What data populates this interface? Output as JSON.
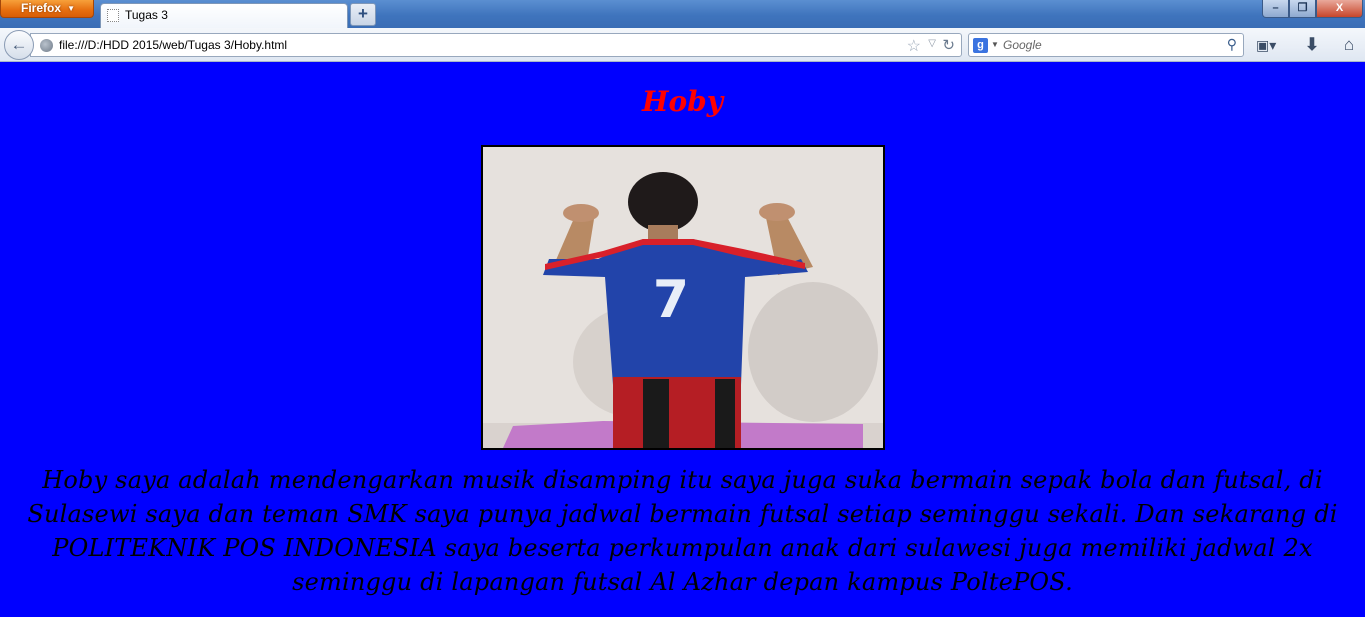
{
  "browser": {
    "menu_label": "Firefox",
    "tab": {
      "title": "Tugas 3"
    },
    "address": "file:///D:/HDD 2015/web/Tugas 3/Hoby.html",
    "search": {
      "engine": "Google",
      "placeholder": "Google"
    },
    "new_tab_label": "+",
    "window_controls": {
      "minimize": "–",
      "restore": "❐",
      "close": "X"
    }
  },
  "page": {
    "background_color": "#0000ff",
    "heading": "Hoby",
    "heading_color": "#ff0000",
    "photo": {
      "jersey_number": "7"
    },
    "paragraph": "Hoby saya adalah mendengarkan musik disamping itu saya juga suka bermain sepak bola dan futsal, di Sulasewi saya dan teman SMK saya punya jadwal bermain futsal setiap seminggu sekali. Dan sekarang di POLITEKNIK POS INDONESIA saya beserta perkumpulan anak dari sulawesi juga memiliki jadwal 2x seminggu di lapangan futsal Al Azhar depan kampus PoltePOS."
  }
}
